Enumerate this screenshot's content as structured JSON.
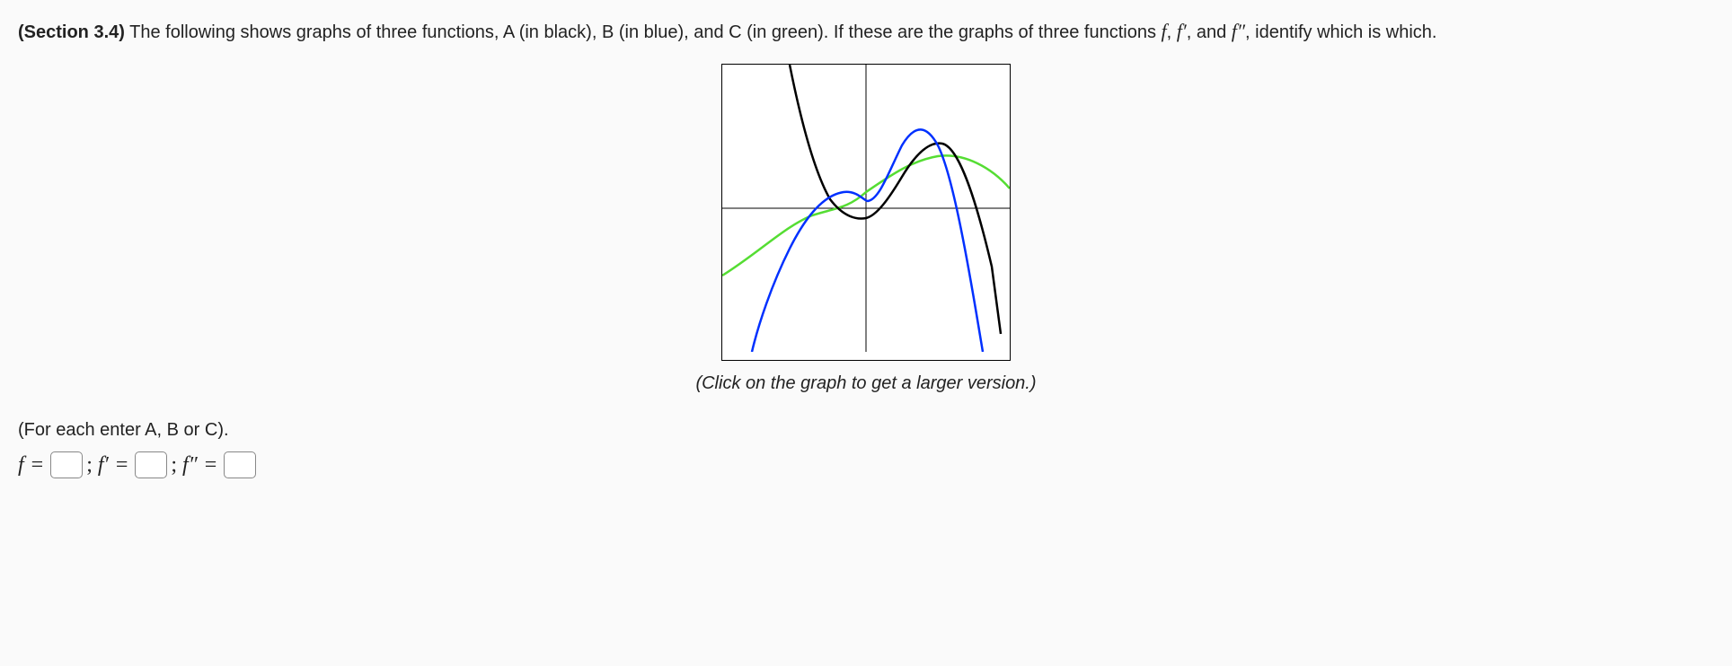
{
  "question": {
    "section_label": "(Section 3.4)",
    "intro_text_1": " The following shows graphs of three functions, A (in black), B (in blue), and C (in green). If these are the graphs of three functions ",
    "math_f": "f",
    "comma1": ", ",
    "math_fprime": "f′",
    "comma2": ", and ",
    "math_fpp": "f″",
    "intro_text_2": ", identify which is which."
  },
  "graph": {
    "caption": "(Click on the graph to get a larger version.)"
  },
  "instruction": "(For each enter A, B or C).",
  "answers": {
    "f_label": "f",
    "fprime_label": "f′",
    "fpp_label": "f″",
    "eq": "=",
    "sep": ";",
    "f_value": "",
    "fprime_value": "",
    "fpp_value": ""
  },
  "chart_data": {
    "type": "line",
    "title": "",
    "xlabel": "",
    "ylabel": "",
    "xlim": [
      -3,
      3
    ],
    "ylim": [
      -3,
      3
    ],
    "series": [
      {
        "name": "A (black)",
        "color": "#000000",
        "x": [
          -1.6,
          -1.2,
          -0.8,
          -0.4,
          0,
          0.4,
          0.8,
          1.2,
          1.6,
          2.0,
          2.4,
          2.8
        ],
        "y": [
          3.0,
          1.3,
          0.3,
          -0.15,
          -0.2,
          0.15,
          0.7,
          1.2,
          1.35,
          0.9,
          -0.4,
          -2.6
        ]
      },
      {
        "name": "B (blue)",
        "color": "#0030ff",
        "x": [
          -2.4,
          -2.0,
          -1.6,
          -1.2,
          -0.8,
          -0.4,
          0,
          0.4,
          0.8,
          1.2,
          1.6,
          2.0,
          2.4
        ],
        "y": [
          -3.0,
          -2.6,
          -1.7,
          -0.65,
          0.1,
          0.35,
          0.15,
          0.5,
          1.4,
          1.3,
          -0.3,
          -2.3,
          -3.0
        ]
      },
      {
        "name": "C (green)",
        "color": "#55dd33",
        "x": [
          -3.0,
          -2.4,
          -1.8,
          -1.2,
          -0.6,
          0,
          0.6,
          1.2,
          1.8,
          2.4,
          3.0
        ],
        "y": [
          -1.4,
          -0.7,
          -0.15,
          0.2,
          0.25,
          0.35,
          0.7,
          1.0,
          1.1,
          0.75,
          0.3
        ]
      }
    ]
  }
}
